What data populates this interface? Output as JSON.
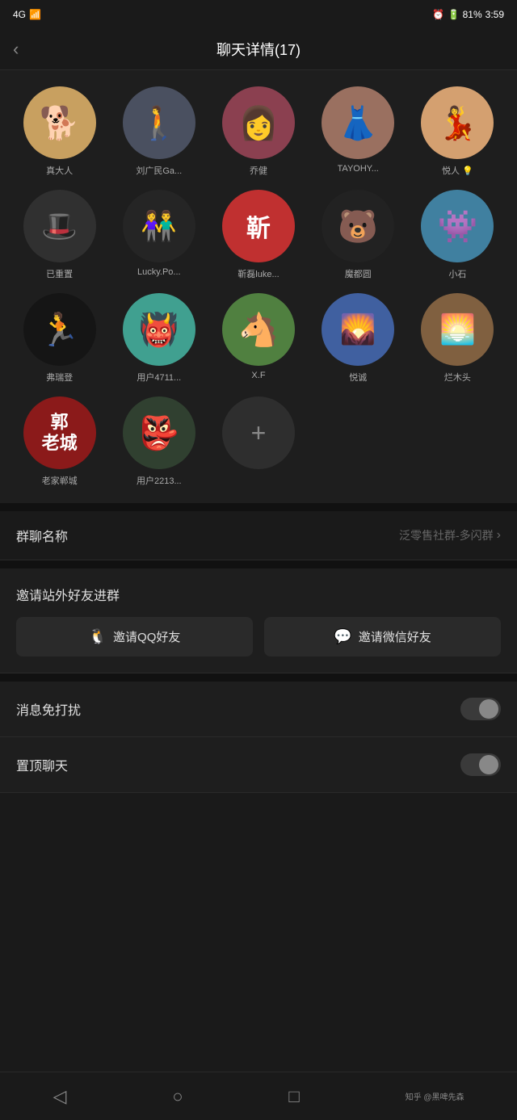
{
  "statusBar": {
    "left": "4G",
    "right": "81% 3:59"
  },
  "header": {
    "title": "聊天详情(17)",
    "back": "<"
  },
  "members": [
    {
      "name": "真大人",
      "avatarClass": "av-shiba",
      "emoji": "🐕"
    },
    {
      "name": "刘广民Ga...",
      "avatarClass": "av-person",
      "emoji": "🧍"
    },
    {
      "name": "乔健",
      "avatarClass": "av-girl",
      "emoji": "👩"
    },
    {
      "name": "TAYOHY...",
      "avatarClass": "av-lady",
      "emoji": "👗"
    },
    {
      "name": "悦人 💡",
      "avatarClass": "av-vintage",
      "emoji": "💃"
    },
    {
      "name": "已重置",
      "avatarClass": "av-hat",
      "emoji": "🎩"
    },
    {
      "name": "Lucky.Po...",
      "avatarClass": "av-couple",
      "emoji": "👫"
    },
    {
      "name": "靳磊luke...",
      "avatarClass": "av-red",
      "text": "靳"
    },
    {
      "name": "魔都圆",
      "avatarClass": "av-kumamon",
      "emoji": "🐻"
    },
    {
      "name": "小石",
      "avatarClass": "av-blue-monster",
      "emoji": "👾"
    },
    {
      "name": "弗瑞登",
      "avatarClass": "av-runner",
      "emoji": "🏃"
    },
    {
      "name": "用户4711...",
      "avatarClass": "av-teal-monster",
      "emoji": "👹"
    },
    {
      "name": "X.F",
      "avatarClass": "av-horse",
      "emoji": "🐴"
    },
    {
      "name": "悦诚",
      "avatarClass": "av-field",
      "emoji": "🌄"
    },
    {
      "name": "烂木头",
      "avatarClass": "av-outdoor",
      "emoji": "🌅"
    },
    {
      "name": "老家郸城",
      "avatarClass": "av-郭",
      "text": "郭老城"
    },
    {
      "name": "用户2213...",
      "avatarClass": "av-green-monster",
      "emoji": "👺"
    }
  ],
  "settings": {
    "groupNameLabel": "群聊名称",
    "groupNameValue": "泛零售社群-多闪群",
    "inviteSectionTitle": "邀请站外好友进群",
    "inviteQQ": "邀请QQ好友",
    "inviteWechat": "邀请微信好友",
    "muteLabel": "消息免打扰",
    "pinLabel": "置顶聊天"
  },
  "bottomNav": {
    "back": "◁",
    "home": "○",
    "recents": "□",
    "brand": "知乎 @黑啤先森"
  }
}
